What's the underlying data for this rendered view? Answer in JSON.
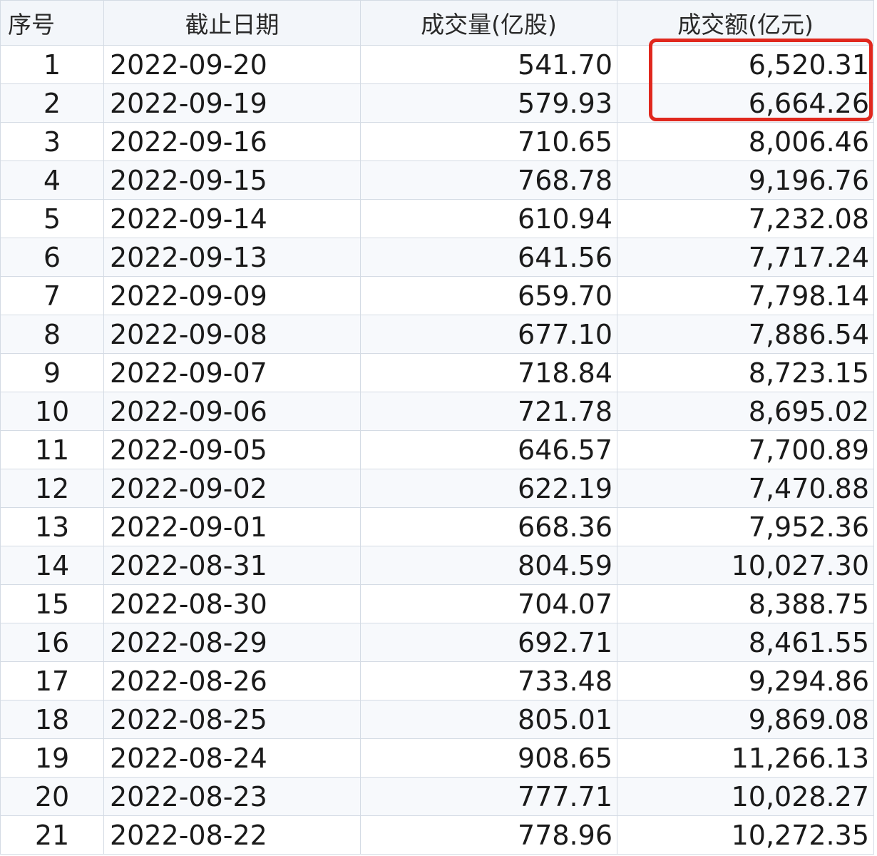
{
  "table": {
    "columns": [
      "序号",
      "截止日期",
      "成交量(亿股)",
      "成交额(亿元)"
    ],
    "rows": [
      [
        "1",
        "2022-09-20",
        "541.70",
        "6,520.31"
      ],
      [
        "2",
        "2022-09-19",
        "579.93",
        "6,664.26"
      ],
      [
        "3",
        "2022-09-16",
        "710.65",
        "8,006.46"
      ],
      [
        "4",
        "2022-09-15",
        "768.78",
        "9,196.76"
      ],
      [
        "5",
        "2022-09-14",
        "610.94",
        "7,232.08"
      ],
      [
        "6",
        "2022-09-13",
        "641.56",
        "7,717.24"
      ],
      [
        "7",
        "2022-09-09",
        "659.70",
        "7,798.14"
      ],
      [
        "8",
        "2022-09-08",
        "677.10",
        "7,886.54"
      ],
      [
        "9",
        "2022-09-07",
        "718.84",
        "8,723.15"
      ],
      [
        "10",
        "2022-09-06",
        "721.78",
        "8,695.02"
      ],
      [
        "11",
        "2022-09-05",
        "646.57",
        "7,700.89"
      ],
      [
        "12",
        "2022-09-02",
        "622.19",
        "7,470.88"
      ],
      [
        "13",
        "2022-09-01",
        "668.36",
        "7,952.36"
      ],
      [
        "14",
        "2022-08-31",
        "804.59",
        "10,027.30"
      ],
      [
        "15",
        "2022-08-30",
        "704.07",
        "8,388.75"
      ],
      [
        "16",
        "2022-08-29",
        "692.71",
        "8,461.55"
      ],
      [
        "17",
        "2022-08-26",
        "733.48",
        "9,294.86"
      ],
      [
        "18",
        "2022-08-25",
        "805.01",
        "9,869.08"
      ],
      [
        "19",
        "2022-08-24",
        "908.65",
        "11,266.13"
      ],
      [
        "20",
        "2022-08-23",
        "777.71",
        "10,028.27"
      ],
      [
        "21",
        "2022-08-22",
        "778.96",
        "10,272.35"
      ]
    ]
  },
  "highlight": {
    "color": "#e0281e",
    "column": "成交额(亿元)",
    "rows": [
      "1",
      "2"
    ]
  }
}
